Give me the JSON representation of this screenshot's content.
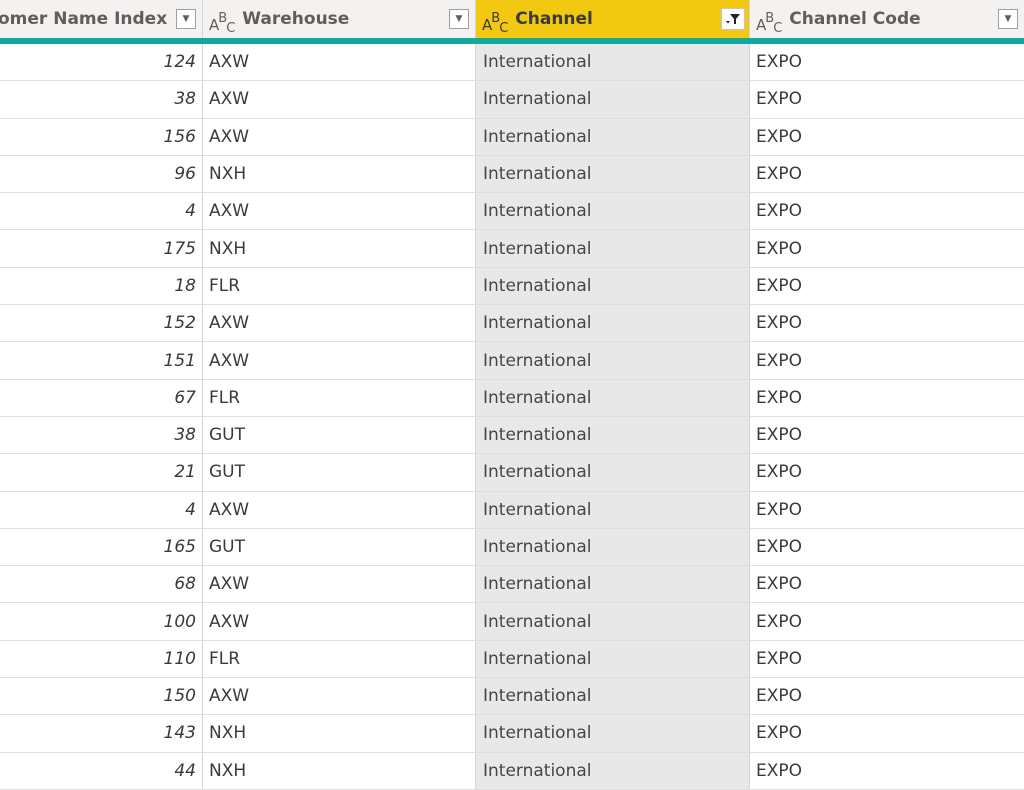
{
  "columns": [
    {
      "label": "omer Name Index",
      "type_icon": "",
      "filter_active": false
    },
    {
      "label": "Warehouse",
      "type_icon": "text-type-icon",
      "filter_active": false
    },
    {
      "label": "Channel",
      "type_icon": "text-type-icon",
      "filter_active": true
    },
    {
      "label": "Channel Code",
      "type_icon": "text-type-icon",
      "filter_active": false
    }
  ],
  "type_icon_text": {
    "a": "A",
    "b": "B",
    "c": "C"
  },
  "dropdown_glyph": "▼",
  "filter_glyph": "⏷",
  "colors": {
    "active_header": "#f2c811",
    "header_underline": "#13a89e",
    "selected_column_bg": "#e8e8e8"
  },
  "rows": [
    {
      "index": "124",
      "warehouse": "AXW",
      "channel": "International",
      "code": "EXPO"
    },
    {
      "index": "38",
      "warehouse": "AXW",
      "channel": "International",
      "code": "EXPO"
    },
    {
      "index": "156",
      "warehouse": "AXW",
      "channel": "International",
      "code": "EXPO"
    },
    {
      "index": "96",
      "warehouse": "NXH",
      "channel": "International",
      "code": "EXPO"
    },
    {
      "index": "4",
      "warehouse": "AXW",
      "channel": "International",
      "code": "EXPO"
    },
    {
      "index": "175",
      "warehouse": "NXH",
      "channel": "International",
      "code": "EXPO"
    },
    {
      "index": "18",
      "warehouse": "FLR",
      "channel": "International",
      "code": "EXPO"
    },
    {
      "index": "152",
      "warehouse": "AXW",
      "channel": "International",
      "code": "EXPO"
    },
    {
      "index": "151",
      "warehouse": "AXW",
      "channel": "International",
      "code": "EXPO"
    },
    {
      "index": "67",
      "warehouse": "FLR",
      "channel": "International",
      "code": "EXPO"
    },
    {
      "index": "38",
      "warehouse": "GUT",
      "channel": "International",
      "code": "EXPO"
    },
    {
      "index": "21",
      "warehouse": "GUT",
      "channel": "International",
      "code": "EXPO"
    },
    {
      "index": "4",
      "warehouse": "AXW",
      "channel": "International",
      "code": "EXPO"
    },
    {
      "index": "165",
      "warehouse": "GUT",
      "channel": "International",
      "code": "EXPO"
    },
    {
      "index": "68",
      "warehouse": "AXW",
      "channel": "International",
      "code": "EXPO"
    },
    {
      "index": "100",
      "warehouse": "AXW",
      "channel": "International",
      "code": "EXPO"
    },
    {
      "index": "110",
      "warehouse": "FLR",
      "channel": "International",
      "code": "EXPO"
    },
    {
      "index": "150",
      "warehouse": "AXW",
      "channel": "International",
      "code": "EXPO"
    },
    {
      "index": "143",
      "warehouse": "NXH",
      "channel": "International",
      "code": "EXPO"
    },
    {
      "index": "44",
      "warehouse": "NXH",
      "channel": "International",
      "code": "EXPO"
    }
  ]
}
